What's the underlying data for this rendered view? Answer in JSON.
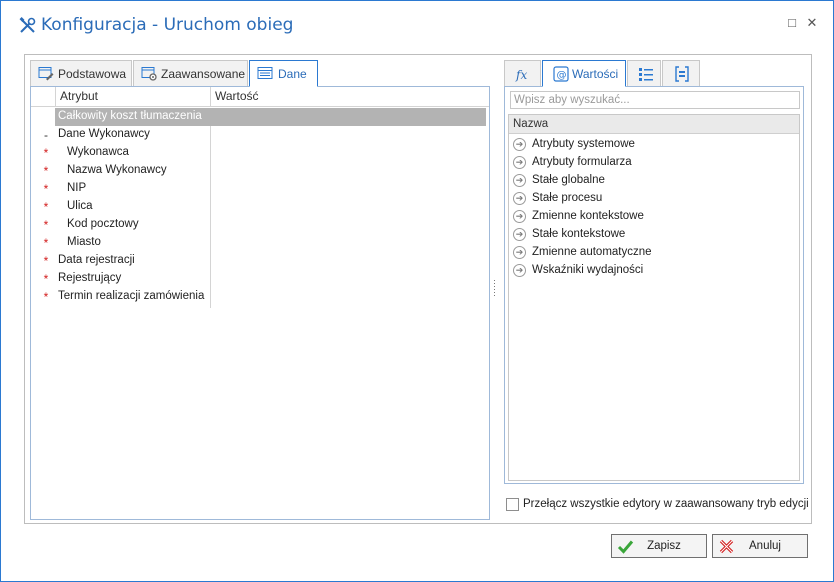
{
  "window": {
    "title": "Konfiguracja - Uruchom obieg",
    "maximize_glyph": "□",
    "close_glyph": "✕"
  },
  "left_tabs": [
    {
      "label": "Podstawowa",
      "icon": "form-edit-icon"
    },
    {
      "label": "Zaawansowane",
      "icon": "form-settings-icon"
    },
    {
      "label": "Dane",
      "icon": "data-table-icon",
      "active": true
    }
  ],
  "grid": {
    "col_attribute": "Atrybut",
    "col_value": "Wartość",
    "rows": [
      {
        "marker": "",
        "name": "Całkowity koszt tłumaczenia",
        "indent": 0,
        "selected": true
      },
      {
        "marker": "-",
        "name": "Dane Wykonawcy",
        "indent": 0
      },
      {
        "marker": "*",
        "name": "Wykonawca",
        "indent": 1
      },
      {
        "marker": "*",
        "name": "Nazwa Wykonawcy",
        "indent": 1
      },
      {
        "marker": "*",
        "name": "NIP",
        "indent": 1
      },
      {
        "marker": "*",
        "name": "Ulica",
        "indent": 1
      },
      {
        "marker": "*",
        "name": "Kod pocztowy",
        "indent": 1
      },
      {
        "marker": "*",
        "name": "Miasto",
        "indent": 1
      },
      {
        "marker": "*",
        "name": "Data rejestracji",
        "indent": 0
      },
      {
        "marker": "*",
        "name": "Rejestrujący",
        "indent": 0
      },
      {
        "marker": "*",
        "name": "Termin realizacji zamówienia",
        "indent": 0
      }
    ]
  },
  "right_tabs": [
    {
      "label": "",
      "icon": "function-fx-icon"
    },
    {
      "label": "Wartości",
      "icon": "at-value-icon",
      "active": true
    },
    {
      "label": "",
      "icon": "list-icon"
    },
    {
      "label": "",
      "icon": "bracket-field-icon"
    }
  ],
  "search": {
    "placeholder": "Wpisz aby wyszukać..."
  },
  "values_list": {
    "header": "Nazwa",
    "items": [
      "Atrybuty systemowe",
      "Atrybuty formularza",
      "Stałe globalne",
      "Stałe procesu",
      "Zmienne kontekstowe",
      "Stałe kontekstowe",
      "Zmienne automatyczne",
      "Wskaźniki wydajności"
    ]
  },
  "advanced_toggle": {
    "label": "Przełącz wszystkie edytory w zaawansowany tryb edycji",
    "checked": false
  },
  "buttons": {
    "save": "Zapisz",
    "cancel": "Anuluj"
  },
  "colors": {
    "accent": "#2b79d1",
    "title": "#2b6cb8",
    "required_marker": "#d21c1c",
    "selected_row": "#b3b3b3",
    "save_icon": "#3aa63a",
    "cancel_icon": "#d21c1c"
  }
}
